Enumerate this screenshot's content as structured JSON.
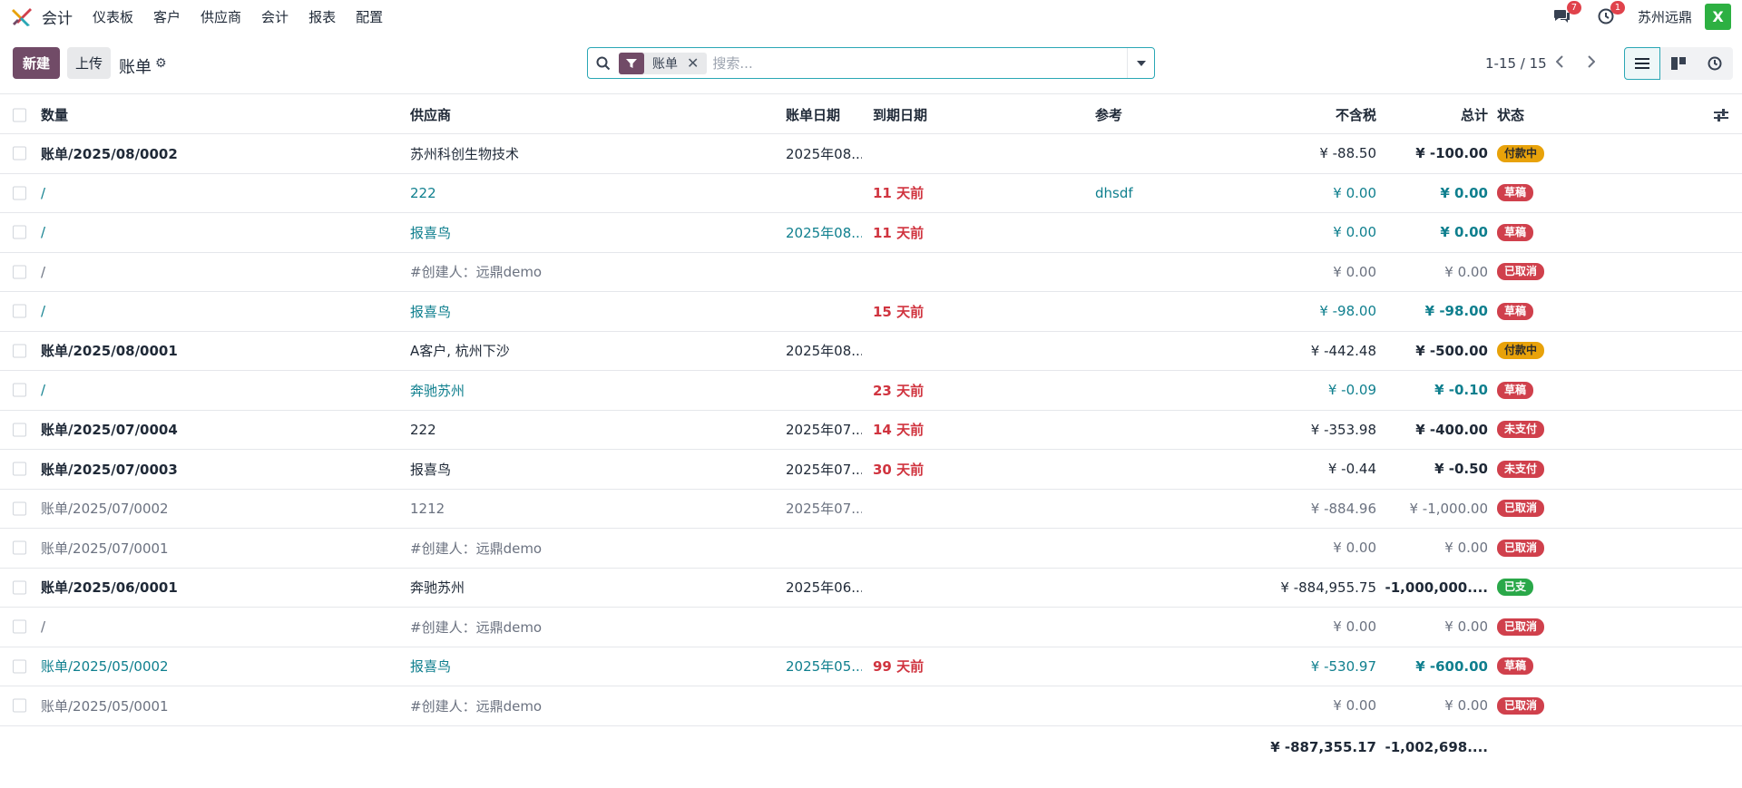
{
  "navbar": {
    "app_name": "会计",
    "menu": [
      "仪表板",
      "客户",
      "供应商",
      "会计",
      "报表",
      "配置"
    ],
    "messages_count": "7",
    "activities_count": "1",
    "company": "苏州远鼎",
    "avatar_letter": "X"
  },
  "control": {
    "new_label": "新建",
    "upload_label": "上传",
    "title": "账单",
    "facet_label": "账单",
    "search_placeholder": "搜索...",
    "pager": "1-15 / 15"
  },
  "table": {
    "headers": {
      "number": "数量",
      "vendor": "供应商",
      "bill_date": "账单日期",
      "due_date": "到期日期",
      "reference": "参考",
      "untaxed": "不含税",
      "total": "总计",
      "state": "状态"
    },
    "rows": [
      {
        "number": "账单/2025/08/0002",
        "vendor": "苏州科创生物技术",
        "bill_date": "2025年08...",
        "due": "",
        "ref": "",
        "untaxed": "¥ -88.50",
        "total": "¥ -100.00",
        "state": "付款中"
      },
      {
        "number": "/",
        "vendor": "222",
        "bill_date": "",
        "due": "11 天前",
        "ref": "dhsdf",
        "untaxed": "¥ 0.00",
        "total": "¥ 0.00",
        "state": "草稿"
      },
      {
        "number": "/",
        "vendor": "报喜鸟",
        "bill_date": "2025年08...",
        "due": "11 天前",
        "ref": "",
        "untaxed": "¥ 0.00",
        "total": "¥ 0.00",
        "state": "草稿"
      },
      {
        "number": "/",
        "vendor": "#创建人：远鼎demo",
        "bill_date": "",
        "due": "",
        "ref": "",
        "untaxed": "¥ 0.00",
        "total": "¥ 0.00",
        "state": "已取消"
      },
      {
        "number": "/",
        "vendor": "报喜鸟",
        "bill_date": "",
        "due": "15 天前",
        "ref": "",
        "untaxed": "¥ -98.00",
        "total": "¥ -98.00",
        "state": "草稿"
      },
      {
        "number": "账单/2025/08/0001",
        "vendor": "A客户, 杭州下沙",
        "bill_date": "2025年08...",
        "due": "",
        "ref": "",
        "untaxed": "¥ -442.48",
        "total": "¥ -500.00",
        "state": "付款中"
      },
      {
        "number": "/",
        "vendor": "奔驰苏州",
        "bill_date": "",
        "due": "23 天前",
        "ref": "",
        "untaxed": "¥ -0.09",
        "total": "¥ -0.10",
        "state": "草稿"
      },
      {
        "number": "账单/2025/07/0004",
        "vendor": "222",
        "bill_date": "2025年07...",
        "due": "14 天前",
        "ref": "",
        "untaxed": "¥ -353.98",
        "total": "¥ -400.00",
        "state": "未支付"
      },
      {
        "number": "账单/2025/07/0003",
        "vendor": "报喜鸟",
        "bill_date": "2025年07...",
        "due": "30 天前",
        "ref": "",
        "untaxed": "¥ -0.44",
        "total": "¥ -0.50",
        "state": "未支付"
      },
      {
        "number": "账单/2025/07/0002",
        "vendor": "1212",
        "bill_date": "2025年07...",
        "due": "",
        "ref": "",
        "untaxed": "¥ -884.96",
        "total": "¥ -1,000.00",
        "state": "已取消"
      },
      {
        "number": "账单/2025/07/0001",
        "vendor": "#创建人：远鼎demo",
        "bill_date": "",
        "due": "",
        "ref": "",
        "untaxed": "¥ 0.00",
        "total": "¥ 0.00",
        "state": "已取消"
      },
      {
        "number": "账单/2025/06/0001",
        "vendor": "奔驰苏州",
        "bill_date": "2025年06...",
        "due": "",
        "ref": "",
        "untaxed": "¥ -884,955.75",
        "total": "¥ -1,000,000....",
        "state": "已支"
      },
      {
        "number": "/",
        "vendor": "#创建人：远鼎demo",
        "bill_date": "",
        "due": "",
        "ref": "",
        "untaxed": "¥ 0.00",
        "total": "¥ 0.00",
        "state": "已取消"
      },
      {
        "number": "账单/2025/05/0002",
        "vendor": "报喜鸟",
        "bill_date": "2025年05...",
        "due": "99 天前",
        "ref": "",
        "untaxed": "¥ -530.97",
        "total": "¥ -600.00",
        "state": "草稿"
      },
      {
        "number": "账单/2025/05/0001",
        "vendor": "#创建人：远鼎demo",
        "bill_date": "",
        "due": "",
        "ref": "",
        "untaxed": "¥ 0.00",
        "total": "¥ 0.00",
        "state": "已取消"
      }
    ],
    "totals": {
      "untaxed": "¥ -887,355.17",
      "total": "¥ -1,002,698...."
    }
  },
  "colors": {
    "brand": "#714b67",
    "accent": "#2aa7b5",
    "link": "#0f7f8e",
    "danger": "#d0343f",
    "warning": "#e8a20a",
    "success": "#2aa849"
  }
}
